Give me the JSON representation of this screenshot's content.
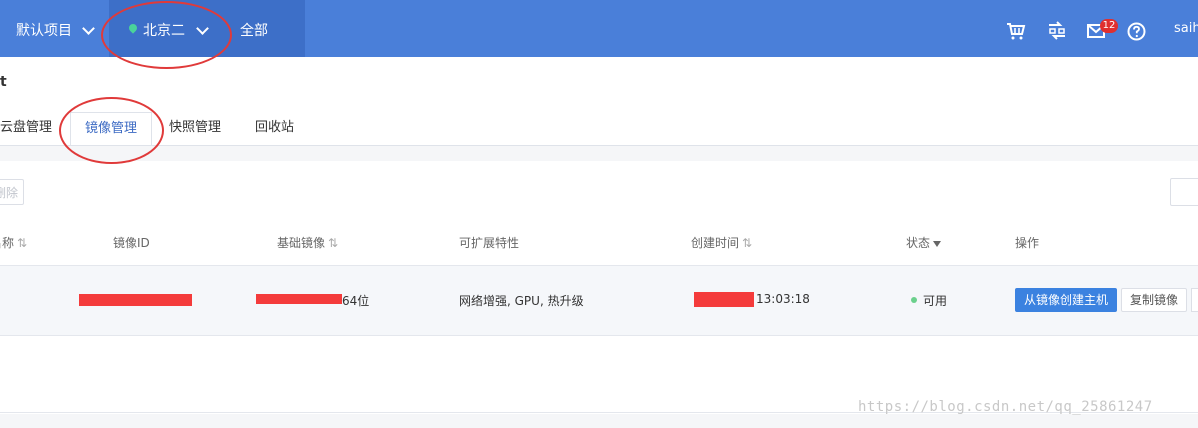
{
  "topbar": {
    "project_label": "默认项目",
    "region_label": "北京二",
    "scope_label": "全部",
    "notification_count": "12",
    "user_name": "saih",
    "icons": [
      "cart-icon",
      "exchange-icon",
      "mail-icon",
      "help-icon"
    ]
  },
  "page": {
    "title": "t",
    "tabs": [
      {
        "label": "云盘管理",
        "active": false
      },
      {
        "label": "镜像管理",
        "active": true
      },
      {
        "label": "快照管理",
        "active": false
      },
      {
        "label": "回收站",
        "active": false
      }
    ]
  },
  "toolbar": {
    "delete_label": "删除"
  },
  "table": {
    "columns": [
      "名称",
      "镜像ID",
      "基础镜像",
      "可扩展特性",
      "创建时间",
      "状态",
      "操作"
    ],
    "rows": [
      {
        "base_image_suffix": "64位",
        "features": "网络增强, GPU, 热升级",
        "created_time": "13:03:18",
        "status": "可用",
        "actions": [
          "从镜像创建主机",
          "复制镜像"
        ]
      }
    ]
  },
  "watermark": "https://blog.csdn.net/qq_25861247",
  "colors": {
    "topbar": "#4a7fd9",
    "accent": "#3c6ac3",
    "primary_button": "#3b82e0",
    "status_ok": "#6bd08c",
    "annotation": "#e03a3a"
  }
}
